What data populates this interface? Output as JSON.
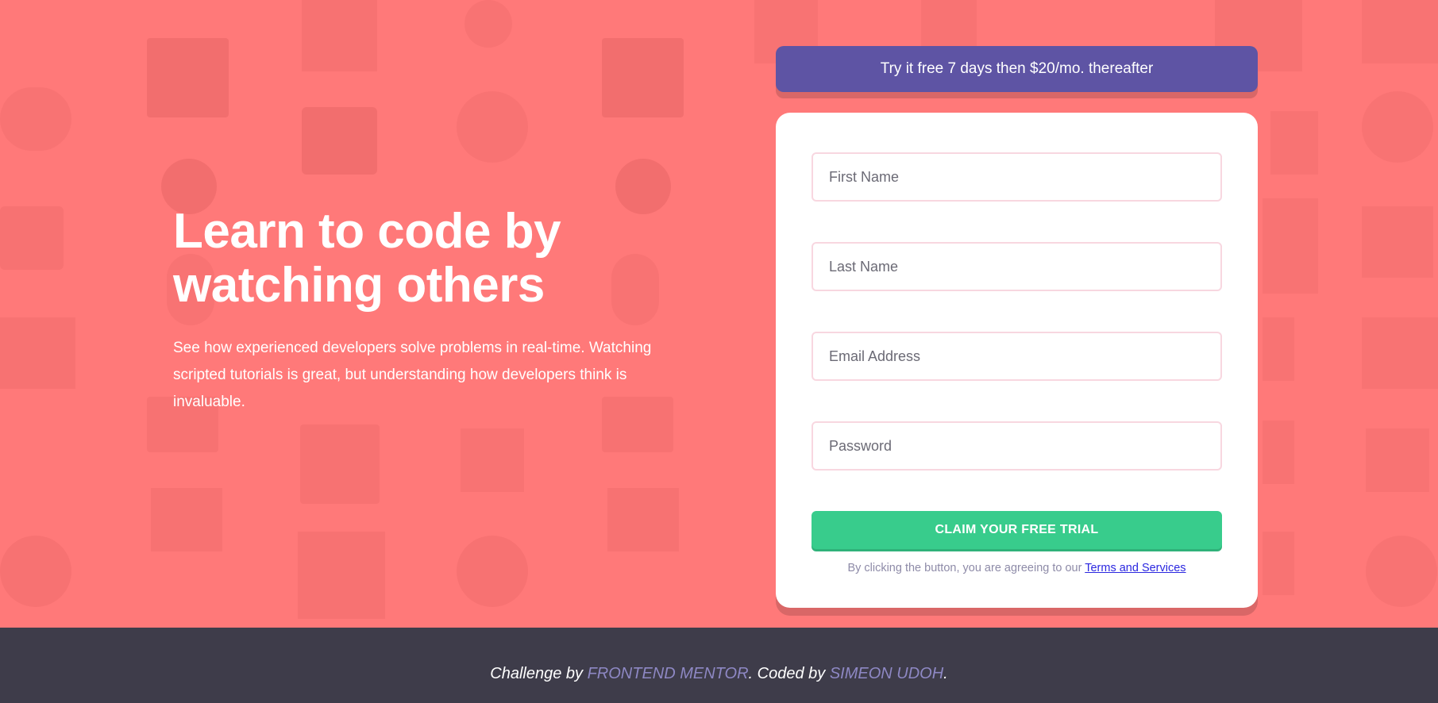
{
  "banner": {
    "text": "Try it free 7 days then $20/mo. thereafter"
  },
  "hero": {
    "title": "Learn to code by watching others",
    "description": "See how experienced developers solve problems in real-time. Watching scripted tutorials is great, but understanding how developers think is invaluable."
  },
  "form": {
    "first_name_placeholder": "First Name",
    "last_name_placeholder": "Last Name",
    "email_placeholder": "Email Address",
    "password_placeholder": "Password",
    "submit_label": "CLAIM YOUR FREE TRIAL",
    "terms_prefix": "By clicking the button, you are agreeing to our ",
    "terms_link": "Terms and Services"
  },
  "footer": {
    "prefix": "Challenge by ",
    "challenge_author": "FRONTEND MENTOR",
    "middle": ". Coded by ",
    "coder": "SIMEON UDOH",
    "suffix": "."
  },
  "colors": {
    "background": "#ff7979",
    "banner": "#5e54a4",
    "button": "#38cc8c",
    "footer": "#3e3c4a",
    "accent": "#8e88c4"
  }
}
